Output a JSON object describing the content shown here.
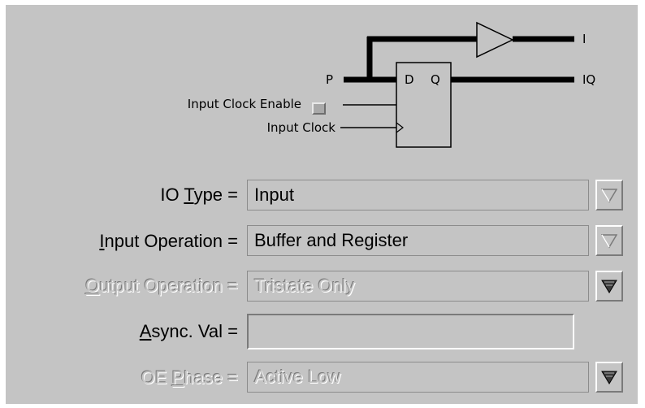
{
  "diagram": {
    "pin_p": "P",
    "pin_d": "D",
    "pin_q": "Q",
    "pin_i": "I",
    "pin_iq": "IQ",
    "clock_enable_label": "Input Clock Enable",
    "clock_label": "Input Clock"
  },
  "form": {
    "io_type": {
      "label_pre": "IO ",
      "label_key": "T",
      "label_post": "ype =",
      "value": "Input",
      "enabled": true
    },
    "input_operation": {
      "label_pre": "",
      "label_key": "I",
      "label_post": "nput Operation =",
      "value": "Buffer and Register",
      "enabled": true
    },
    "output_operation": {
      "label_pre": "",
      "label_key": "O",
      "label_post": "utput Operation =",
      "value": "Tristate Only",
      "enabled": false
    },
    "async_val": {
      "label_pre": "",
      "label_key": "A",
      "label_post": "sync. Val =",
      "value": "",
      "enabled": true
    },
    "oe_phase": {
      "label_pre": "OE ",
      "label_key": "P",
      "label_post": "hase =",
      "value": "Active Low",
      "enabled": false
    }
  },
  "colors": {
    "panel": "#c4c4c4",
    "highlight": "#ffffff",
    "shadow": "#7a7a7a",
    "checkbox": "#a9a9a9"
  },
  "icons": {
    "dropdown": "triangle-down-icon",
    "buffer": "buffer-triangle-icon",
    "clock": "clock-edge-icon"
  }
}
